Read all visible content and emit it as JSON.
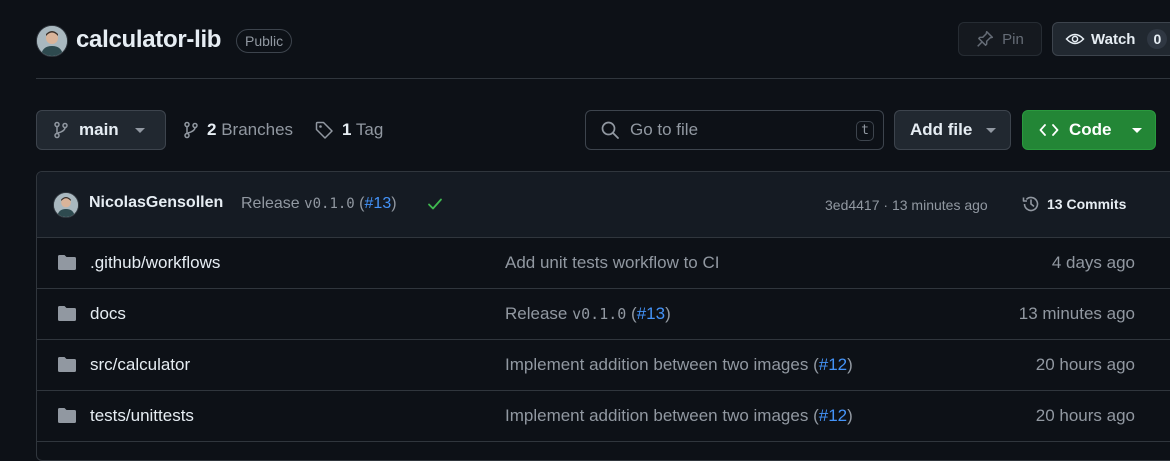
{
  "repo": {
    "name": "calculator-lib",
    "visibility": "Public",
    "pin_label": "Pin",
    "watch_label": "Watch",
    "watch_count": "0"
  },
  "toolbar": {
    "branch": "main",
    "branches_count": "2",
    "branches_label": "Branches",
    "tags_count": "1",
    "tags_label": "Tag",
    "search_placeholder": "Go to file",
    "search_shortcut": "t",
    "add_file_label": "Add file",
    "code_label": "Code"
  },
  "latest_commit": {
    "author": "NicolasGensollen",
    "message_prefix": "Release ",
    "message_version": "v0.1.0",
    "message_pr": "#13",
    "hash": "3ed4417",
    "time": "13 minutes ago",
    "commits_count_label": "13 Commits",
    "status": "success"
  },
  "files": [
    {
      "name": ".github/workflows",
      "type": "folder",
      "message": "Add unit tests workflow to CI",
      "message_version": "",
      "pr": "",
      "age": "4 days ago"
    },
    {
      "name": "docs",
      "type": "folder",
      "message": "Release ",
      "message_version": "v0.1.0",
      "pr": "#13",
      "age": "13 minutes ago"
    },
    {
      "name": "src/calculator",
      "type": "folder",
      "message": "Implement addition between two images ",
      "message_version": "",
      "pr": "#12",
      "age": "20 hours ago"
    },
    {
      "name": "tests/unittests",
      "type": "folder",
      "message": "Implement addition between two images ",
      "message_version": "",
      "pr": "#12",
      "age": "20 hours ago"
    }
  ],
  "colors": {
    "background": "#0d1117",
    "accent_link": "#4493f8",
    "code_button": "#238636",
    "success": "#3fb950",
    "muted_text": "#9198a1",
    "folder_icon": "#9198a1"
  }
}
